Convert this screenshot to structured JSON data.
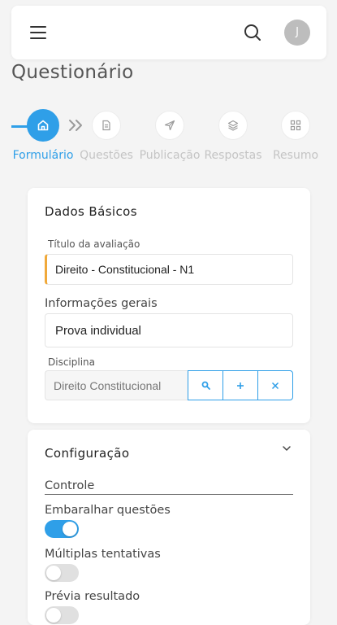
{
  "header": {
    "menu_icon": "hamburger-menu-icon",
    "search_icon": "search-icon",
    "avatar_initial": "J"
  },
  "page": {
    "title": "Questionário"
  },
  "stepper": {
    "active_color": "#2f9fe8",
    "steps": [
      {
        "label": "Formulário",
        "icon": "home-icon",
        "active": true
      },
      {
        "label": "Questões",
        "icon": "document-icon",
        "active": false
      },
      {
        "label": "Publicação",
        "icon": "send-icon",
        "active": false
      },
      {
        "label": "Respostas",
        "icon": "layers-icon",
        "active": false
      },
      {
        "label": "Resumo",
        "icon": "grid-icon",
        "active": false
      }
    ]
  },
  "basic": {
    "title": "Dados Básicos",
    "eval_title_label": "Título da avaliação",
    "eval_title_value": "Direito - Constitucional - N1",
    "info_label": "Informações gerais",
    "info_value": "Prova individual",
    "discipline_label": "Disciplina",
    "discipline_value": "Direito Constitucional",
    "accent_color": "#f0a93a"
  },
  "config": {
    "title": "Configuração",
    "control_label": "Controle",
    "toggles": [
      {
        "label": "Embaralhar questões",
        "on": true
      },
      {
        "label": "Múltiplas tentativas",
        "on": false
      },
      {
        "label": "Prévia resultado",
        "on": false
      }
    ]
  }
}
